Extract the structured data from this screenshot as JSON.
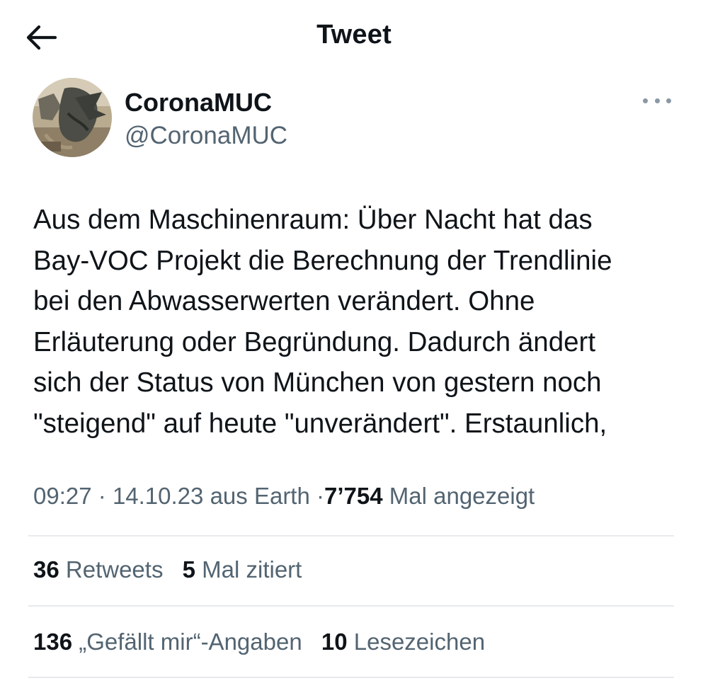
{
  "header": {
    "title": "Tweet",
    "back_icon": "arrow-left-icon"
  },
  "author": {
    "display_name": "CoronaMUC",
    "handle": "@CoronaMUC",
    "more_icon": "more-horizontal-icon"
  },
  "tweet": {
    "text": "Aus dem Maschinenraum: Über Nacht hat das\nBay-VOC Projekt die Berechnung der Trendlinie\nbei den Abwasserwerten verändert. Ohne\nErläuterung oder Begründung. Dadurch ändert\nsich der Status von München von gestern noch\n\"steigend\" auf heute \"unverändert\". Erstaunlich,"
  },
  "meta": {
    "time": "09:27",
    "separator": "·",
    "date": "14.10.23",
    "source": "aus Earth",
    "views_count": "7’754",
    "views_label": "Mal angezeigt"
  },
  "stats_row1": {
    "retweets_count": "36",
    "retweets_label": "Retweets",
    "quotes_count": "5",
    "quotes_label": "Mal zitiert"
  },
  "stats_row2": {
    "likes_count": "136",
    "likes_label": "„Gefällt mir“-Angaben",
    "bookmarks_count": "10",
    "bookmarks_label": "Lesezeichen"
  },
  "colors": {
    "text_primary": "#0f1419",
    "text_secondary": "#536471",
    "divider": "#e7eaed"
  }
}
